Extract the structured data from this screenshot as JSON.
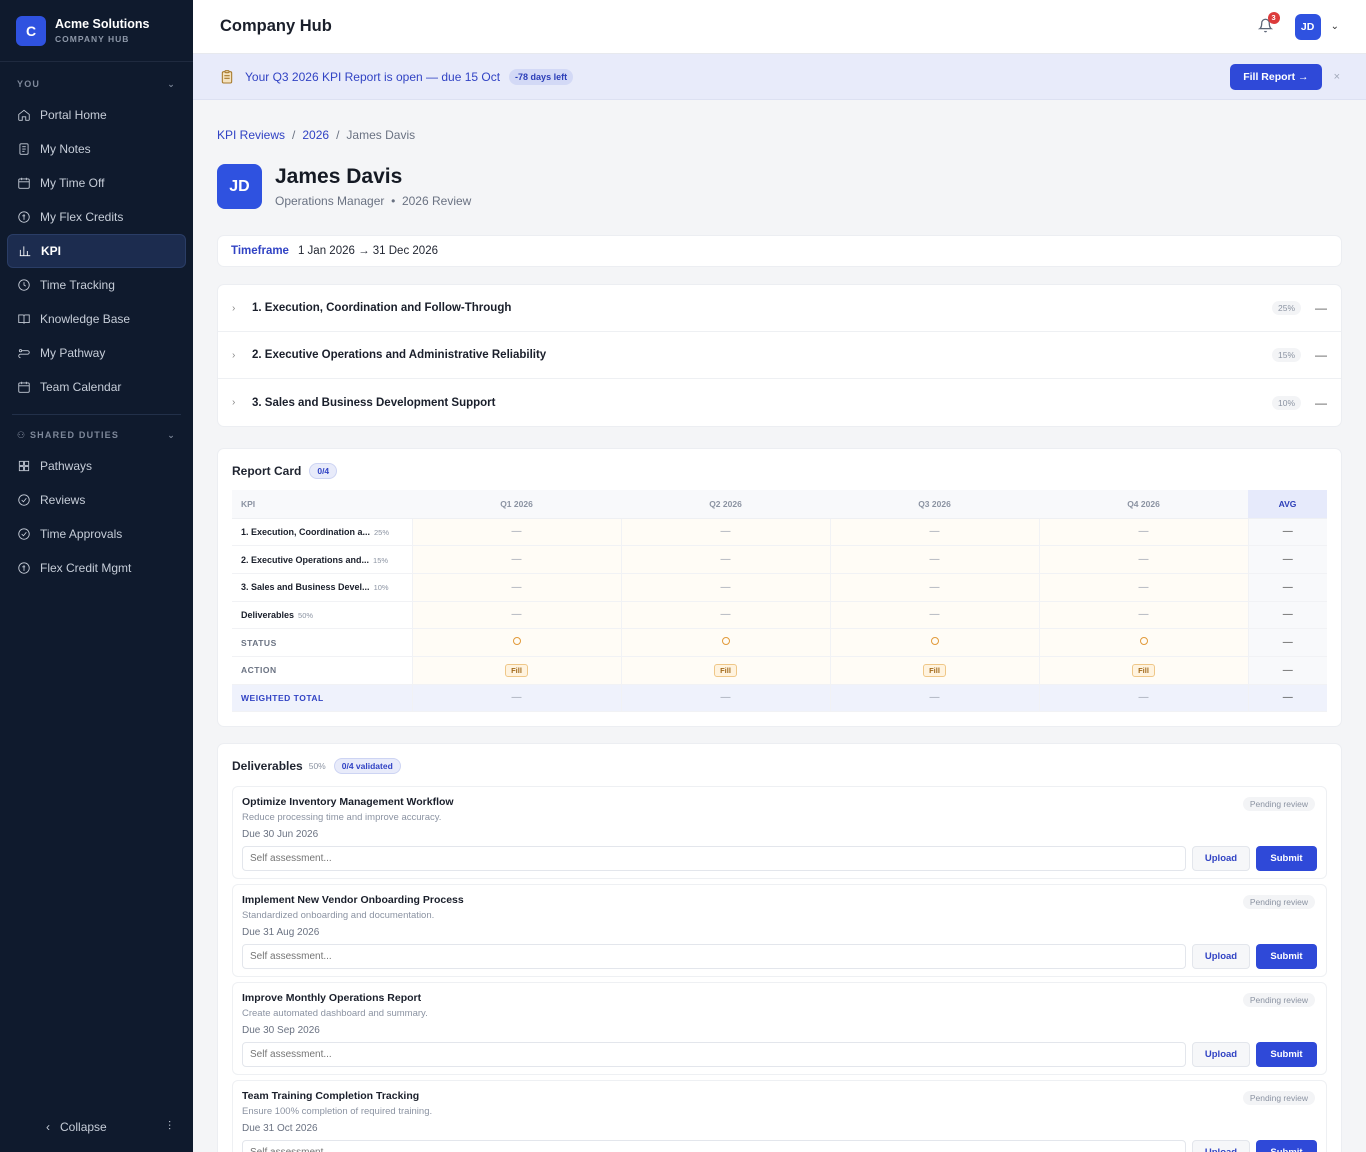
{
  "brand": {
    "initial": "C",
    "name": "Acme Solutions",
    "sub": "COMPANY HUB"
  },
  "sidebar": {
    "you_label": "YOU",
    "you_items": [
      {
        "label": "Portal Home",
        "icon": "home-icon"
      },
      {
        "label": "My Notes",
        "icon": "notes-icon"
      },
      {
        "label": "My Time Off",
        "icon": "calendar-icon"
      },
      {
        "label": "My Flex Credits",
        "icon": "credit-icon"
      },
      {
        "label": "KPI",
        "icon": "chart-icon",
        "active": true
      },
      {
        "label": "Time Tracking",
        "icon": "clock-icon"
      },
      {
        "label": "Knowledge Base",
        "icon": "book-icon"
      },
      {
        "label": "My Pathway",
        "icon": "pathway-icon"
      },
      {
        "label": "Team Calendar",
        "icon": "calendar-icon"
      }
    ],
    "shared_label": "SHARED DUTIES",
    "shared_items": [
      {
        "label": "Pathways",
        "icon": "grid-icon"
      },
      {
        "label": "Reviews",
        "icon": "check-circle-icon"
      },
      {
        "label": "Time Approvals",
        "icon": "check-circle-icon"
      },
      {
        "label": "Flex Credit Mgmt",
        "icon": "credit-icon"
      }
    ],
    "collapse_label": "Collapse"
  },
  "topbar": {
    "title": "Company Hub",
    "notif_count": "3",
    "avatar": "JD"
  },
  "banner": {
    "text": "Your Q3 2026 KPI Report is open — due 15 Oct",
    "pill": "-78 days left",
    "button": "Fill Report →",
    "close": "×"
  },
  "breadcrumb": {
    "root": "KPI Reviews",
    "year": "2026",
    "current": "James Davis"
  },
  "profile": {
    "initials": "JD",
    "name": "James Davis",
    "role": "Operations Manager",
    "review": "2026 Review"
  },
  "timeframe": {
    "label": "Timeframe",
    "value": "1 Jan 2026 → 31 Dec 2026"
  },
  "sections": [
    {
      "title": "1. Execution, Coordination and Follow-Through",
      "pct": "25%"
    },
    {
      "title": "2. Executive Operations and Administrative Reliability",
      "pct": "15%"
    },
    {
      "title": "3. Sales and Business Development Support",
      "pct": "10%"
    }
  ],
  "report_card": {
    "title": "Report Card",
    "count": "0/4",
    "headers": [
      "KPI",
      "Q1 2026",
      "Q2 2026",
      "Q3 2026",
      "Q4 2026",
      "AVG"
    ],
    "kpi_rows": [
      {
        "name": "1. Execution, Coordination a...",
        "weight": "25%"
      },
      {
        "name": "2. Executive Operations and...",
        "weight": "15%"
      },
      {
        "name": "3. Sales and Business Devel...",
        "weight": "10%"
      },
      {
        "name": "Deliverables",
        "weight": "50%"
      }
    ],
    "status_label": "STATUS",
    "action_label": "ACTION",
    "action_chip": "Fill",
    "total_label": "WEIGHTED TOTAL",
    "dash": "—"
  },
  "deliverables": {
    "title": "Deliverables",
    "weight": "50%",
    "validated": "0/4 validated",
    "placeholder": "Self assessment...",
    "upload_label": "Upload",
    "submit_label": "Submit",
    "items": [
      {
        "title": "Optimize Inventory Management Workflow",
        "desc": "Reduce processing time and improve accuracy.",
        "due": "Due 30 Jun 2026",
        "status": "Pending review"
      },
      {
        "title": "Implement New Vendor Onboarding Process",
        "desc": "Standardized onboarding and documentation.",
        "due": "Due 31 Aug 2026",
        "status": "Pending review"
      },
      {
        "title": "Improve Monthly Operations Report",
        "desc": "Create automated dashboard and summary.",
        "due": "Due 30 Sep 2026",
        "status": "Pending review"
      },
      {
        "title": "Team Training Completion Tracking",
        "desc": "Ensure 100% completion of required training.",
        "due": "Due 31 Oct 2026",
        "status": "Pending review"
      }
    ]
  },
  "colors": {
    "accent": "#2f49d8",
    "sidebar_bg": "#0f1a2d",
    "warning": "#e29a3a"
  }
}
